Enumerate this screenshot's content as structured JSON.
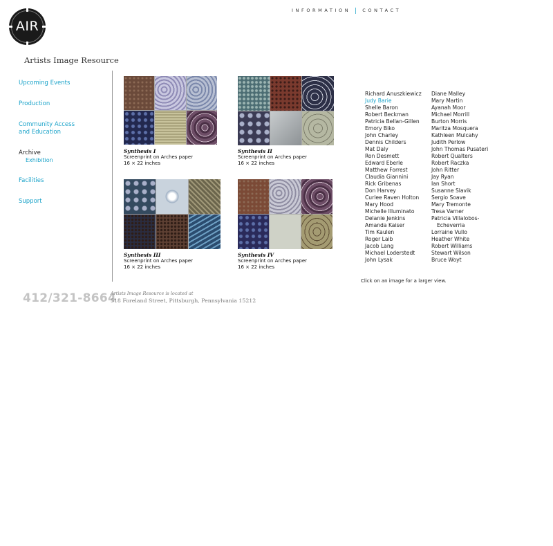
{
  "logo": {
    "text": "AIR"
  },
  "org_name": "Artists Image Resource",
  "topnav": {
    "information": "INFORMATION",
    "separator": "|",
    "contact": "CONTACT"
  },
  "sidebar": {
    "items": [
      {
        "label": "Upcoming Events"
      },
      {
        "label": "Production"
      },
      {
        "label": "Community Access"
      },
      {
        "label": "and Education"
      },
      {
        "label": "Archive"
      },
      {
        "label": "Exhibition"
      },
      {
        "label": "Facilities"
      },
      {
        "label": "Support"
      }
    ]
  },
  "works": [
    {
      "title": "Synthesis I",
      "medium": "Screenprint on Arches paper",
      "size": "16 × 22 inches"
    },
    {
      "title": "Synthesis II",
      "medium": "Screenprint on Arches paper",
      "size": "16 × 22 inches"
    },
    {
      "title": "Synthesis III",
      "medium": "Screenprint on Arches paper",
      "size": "16 × 22 inches"
    },
    {
      "title": "Synthesis IV",
      "medium": "Screenprint on Arches paper",
      "size": "16 × 22 inches"
    }
  ],
  "artists_col1": [
    "Richard Anuszkiewicz",
    "Judy Barie",
    "Shelle Baron",
    "Robert Beckman",
    "Patricia Bellan-Gillen",
    "Emory Biko",
    "John Charley",
    "Dennis Childers",
    "Mat Daly",
    "Ron Desmett",
    "Edward Eberle",
    "Matthew Forrest",
    "Claudia Giannini",
    "Rick Gribenas",
    "Don Harvey",
    "Curlee Raven Holton",
    "Mary Hood",
    "Michelle Illuminato",
    "Delanie Jenkins",
    "Amanda Kaiser",
    "Tim Kaulen",
    "Roger Laib",
    "Jacob Lang",
    "Michael Loderstedt",
    "John Lysak"
  ],
  "artists_col2": [
    "Diane Malley",
    "Mary Martin",
    "Ayanah Moor",
    "Michael Morrill",
    "Burton Morris",
    "Maritza Mosquera",
    "Kathleen Mulcahy",
    "Judith Perlow",
    "John Thomas Pusateri",
    "Robert Qualters",
    "Robert Raczka",
    "John Ritter",
    "Jay Ryan",
    "Ian Short",
    "Susanne Slavik",
    "Sergio Soave",
    "Mary Tremonte",
    "Tresa Varner",
    "Patricia Villalobos-",
    "Echeverria",
    "Lorraine Vullo",
    "Heather White",
    "Robert Williams",
    "Stewart Wilson",
    "Bruce Woyt"
  ],
  "selected_artist": "Judy Barie",
  "hint": "Click on an image for a larger view.",
  "footer": {
    "phone": "412/321-8664",
    "located": "Artists Image Resource is located at",
    "address": "518 Foreland Street, Pittsburgh, Pennsylvania 15212"
  },
  "colors": {
    "accent": "#1aa3c9",
    "text": "#222222",
    "phone": "#c4c4c4"
  }
}
